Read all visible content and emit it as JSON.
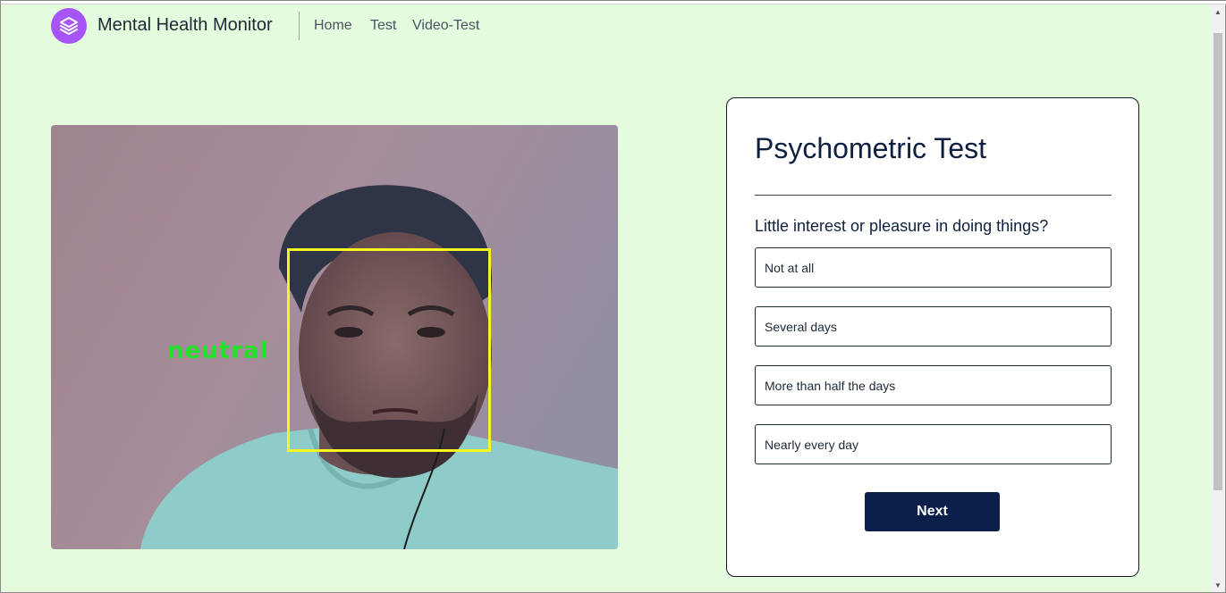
{
  "nav": {
    "brand": "Mental Health Monitor",
    "links": [
      "Home",
      "Test",
      "Video-Test"
    ],
    "logo_icon": "layers-icon",
    "logo_color": "#a855f7"
  },
  "webcam": {
    "emotion_label": "neutral",
    "box_color": "#f5f51f",
    "label_color": "#22e22b"
  },
  "test": {
    "title": "Psychometric Test",
    "question": "Little interest or pleasure in doing things?",
    "options": [
      "Not at all",
      "Several days",
      "More than half the days",
      "Nearly every day"
    ],
    "next_label": "Next",
    "accent": "#0b1f4b"
  },
  "page": {
    "background": "#e4fbdd"
  }
}
